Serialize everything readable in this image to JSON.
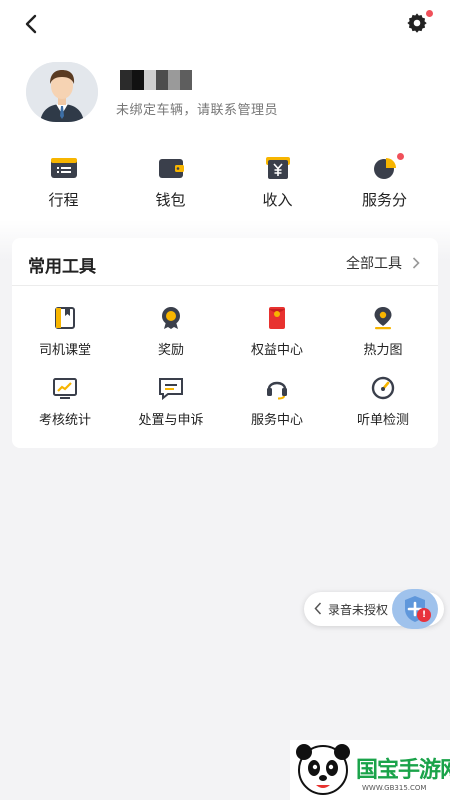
{
  "colors": {
    "accent": "#f7b500",
    "dark": "#3a3f4b",
    "badge": "#f0505a",
    "fab": "#9fc2ec",
    "watermark_green": "#1aa34a"
  },
  "header": {
    "back_icon": "chevron-left-icon",
    "settings_icon": "gear-icon"
  },
  "profile": {
    "name_masked": "",
    "status": "未绑定车辆，请联系管理员"
  },
  "quick_actions": [
    {
      "label": "行程",
      "icon": "trip-list-icon"
    },
    {
      "label": "钱包",
      "icon": "wallet-icon"
    },
    {
      "label": "收入",
      "icon": "income-yen-icon"
    },
    {
      "label": "服务分",
      "icon": "service-score-pie-icon",
      "badge": true
    }
  ],
  "tools": {
    "title": "常用工具",
    "all_label": "全部工具",
    "items": [
      {
        "label": "司机课堂",
        "icon": "book-icon"
      },
      {
        "label": "奖励",
        "icon": "medal-icon"
      },
      {
        "label": "权益中心",
        "icon": "red-packet-icon"
      },
      {
        "label": "热力图",
        "icon": "map-pin-icon"
      },
      {
        "label": "考核统计",
        "icon": "chart-icon"
      },
      {
        "label": "处置与申诉",
        "icon": "message-icon"
      },
      {
        "label": "服务中心",
        "icon": "headset-icon"
      },
      {
        "label": "听单检测",
        "icon": "gauge-icon"
      }
    ]
  },
  "recording": {
    "label": "录音未授权",
    "badge": "!"
  },
  "watermark": {
    "text": "国宝手游网",
    "url": "WWW.GB315.COM"
  }
}
